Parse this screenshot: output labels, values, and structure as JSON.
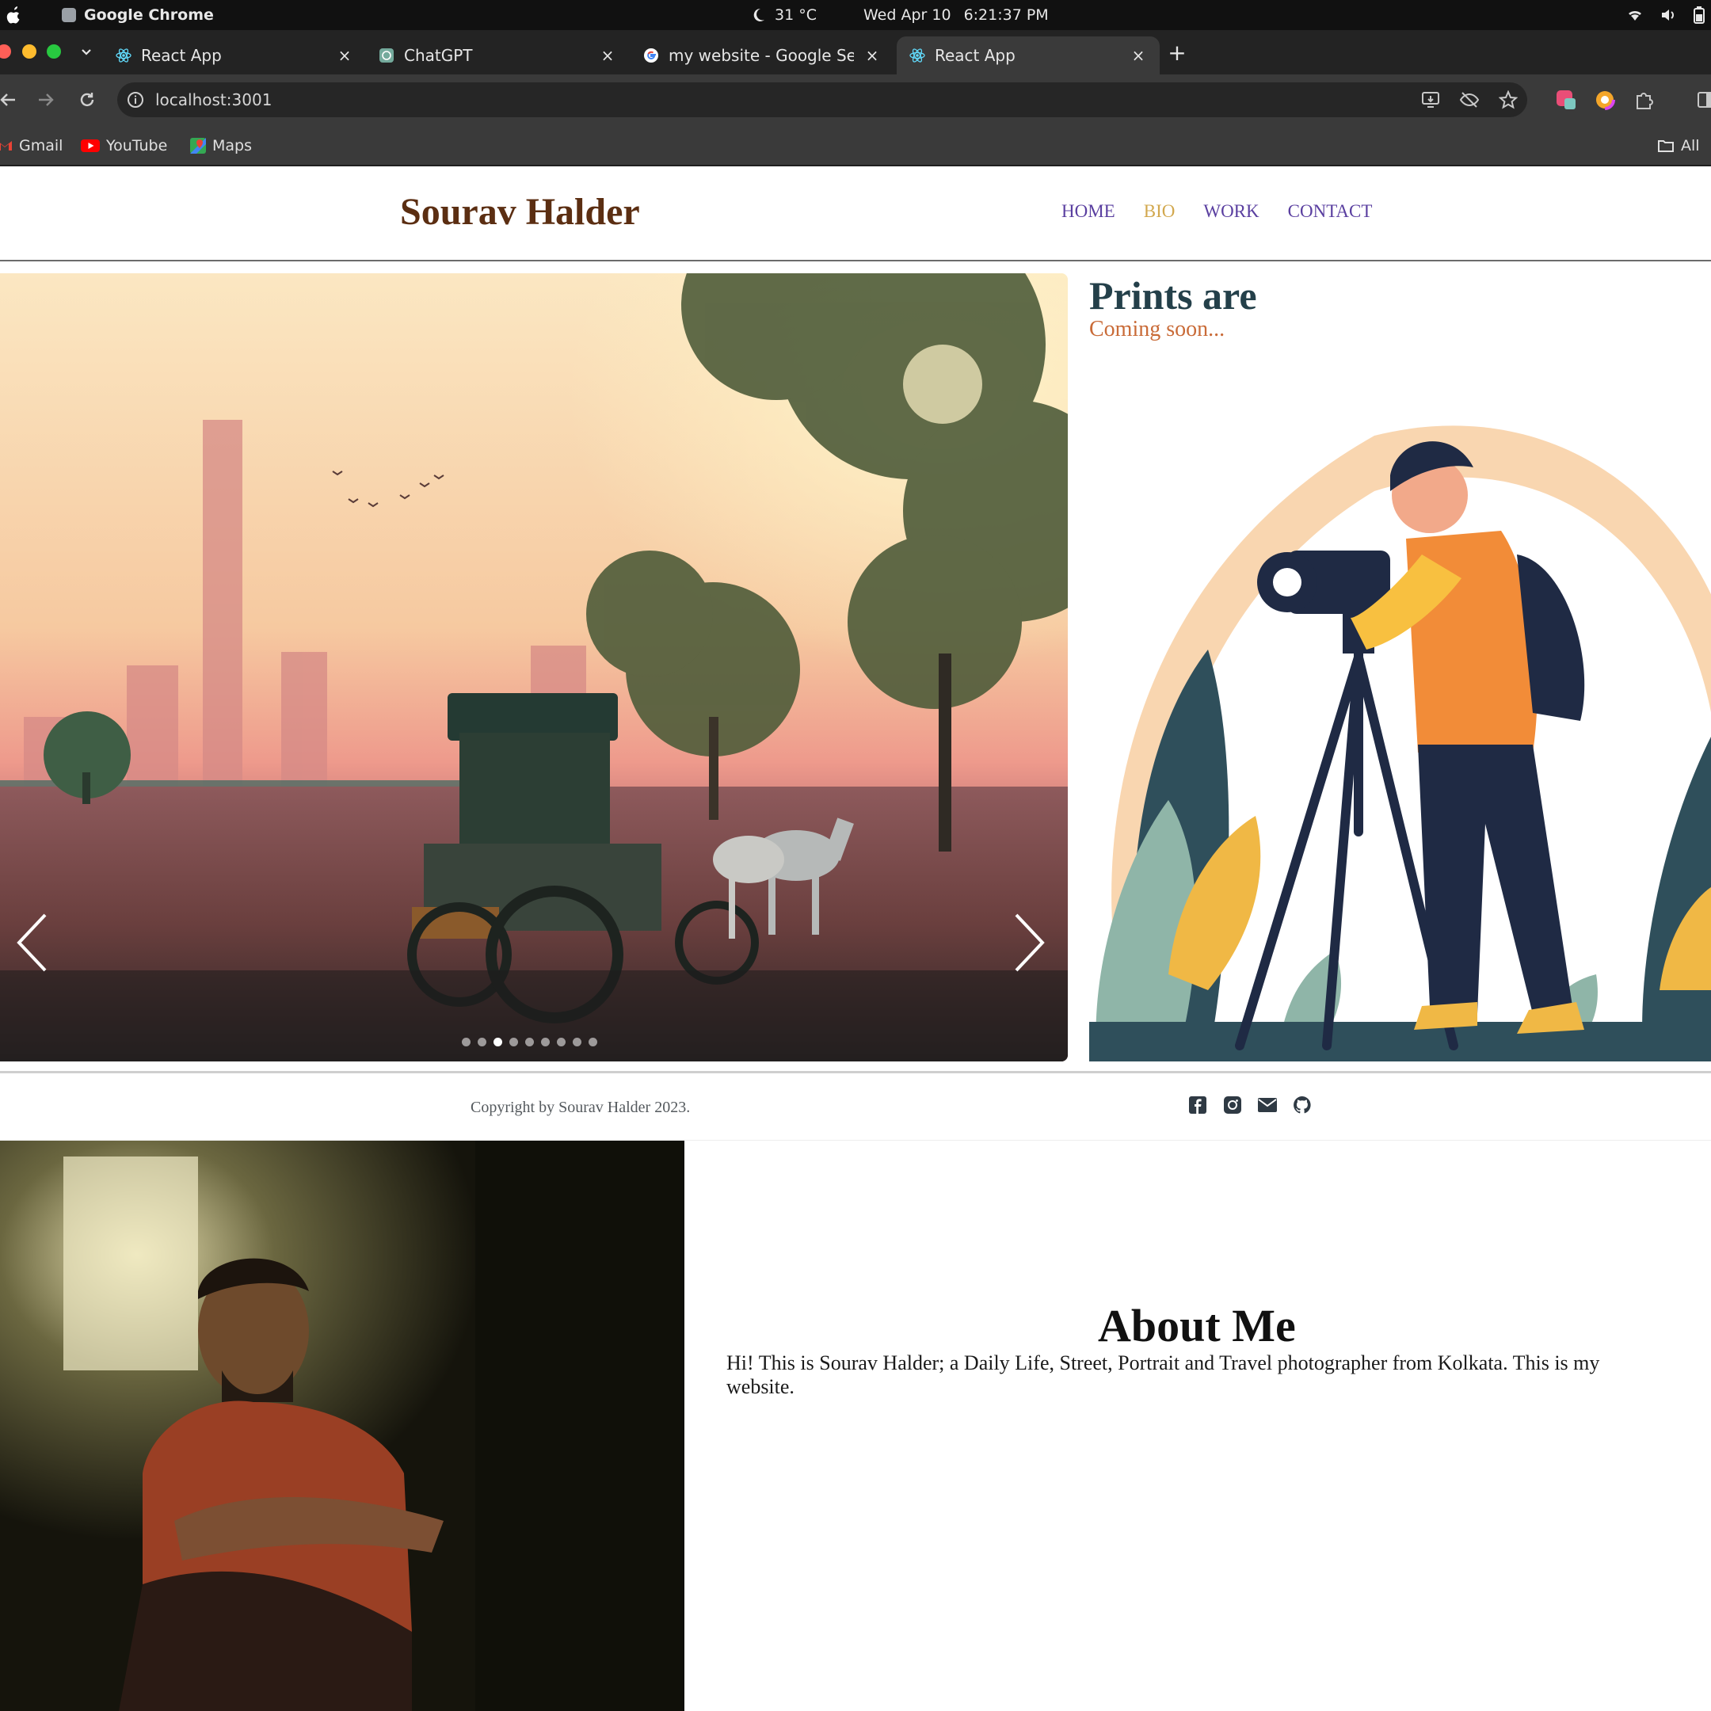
{
  "os": {
    "app_name": "Google Chrome",
    "temperature": "31 °C",
    "date": "Wed Apr 10",
    "time": "6:21:37 PM"
  },
  "browser": {
    "tabs": [
      {
        "title": "React App",
        "icon": "react-icon",
        "active": false
      },
      {
        "title": "ChatGPT",
        "icon": "chatgpt-icon",
        "active": false
      },
      {
        "title": "my website - Google Sea",
        "icon": "google-icon",
        "active": false
      },
      {
        "title": "React App",
        "icon": "react-icon",
        "active": true
      }
    ],
    "url": "localhost:3001",
    "bookmarks": [
      {
        "label": "Gmail",
        "icon": "gmail-icon"
      },
      {
        "label": "YouTube",
        "icon": "youtube-icon"
      },
      {
        "label": "Maps",
        "icon": "maps-icon"
      }
    ],
    "all_bookmarks_label": "All"
  },
  "site": {
    "logo": "Sourav Halder",
    "nav": [
      {
        "label": "HOME",
        "active": false
      },
      {
        "label": "BIO",
        "active": true
      },
      {
        "label": "WORK",
        "active": false
      },
      {
        "label": "CONTACT",
        "active": false
      }
    ],
    "carousel": {
      "slide_count": 9,
      "active_index": 2
    },
    "prints": {
      "title": "Prints are",
      "subtitle": "Coming soon..."
    },
    "footer": {
      "copyright": "Copyright by Sourav Halder 2023.",
      "socials": [
        "facebook-icon",
        "instagram-icon",
        "mail-icon",
        "github-icon"
      ]
    },
    "about": {
      "title": "About Me",
      "text": "Hi! This is Sourav Halder; a Daily Life, Street, Portrait and Travel photographer from Kolkata. This is my website."
    }
  },
  "colors": {
    "logo": "#5b2e12",
    "nav": "#5a3fa0",
    "nav_active": "#d2a84e",
    "prints_title": "#24404a",
    "prints_sub": "#c96b38"
  }
}
